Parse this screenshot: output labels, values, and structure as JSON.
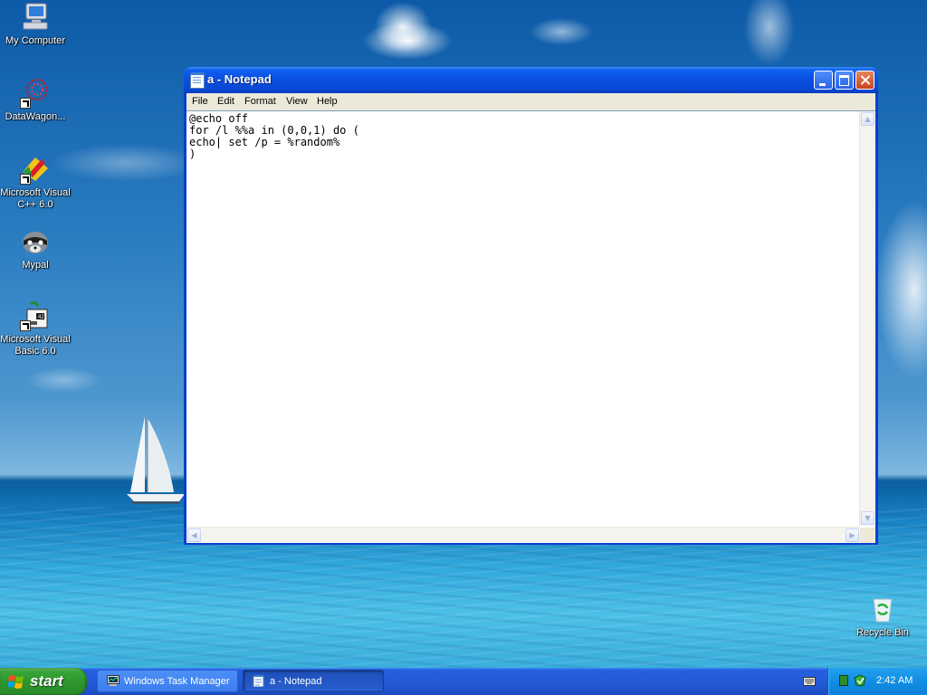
{
  "desktop": {
    "icons": [
      {
        "label": "My Computer",
        "icon": "my-computer-icon"
      },
      {
        "label": "DataWagon...",
        "icon": "datawagon-icon"
      },
      {
        "label": "Microsoft Visual C++ 6.0",
        "icon": "visual-cpp-icon"
      },
      {
        "label": "Mypal",
        "icon": "mypal-raccoon-icon"
      },
      {
        "label": "Microsoft Visual Basic 6.0",
        "icon": "visual-basic-icon"
      },
      {
        "label": "Recycle Bin",
        "icon": "recycle-bin-icon"
      }
    ]
  },
  "notepad": {
    "title": "a - Notepad",
    "menu": [
      "File",
      "Edit",
      "Format",
      "View",
      "Help"
    ],
    "content": "@echo off\nfor /l %%a in (0,0,1) do (\necho| set /p = %random%\n)"
  },
  "taskbar": {
    "start_label": "start",
    "tasks": [
      {
        "label": "Windows Task Manager",
        "icon": "task-manager-icon",
        "active": false
      },
      {
        "label": "a - Notepad",
        "icon": "notepad-icon",
        "active": true
      }
    ],
    "tray": {
      "clock": "2:42 AM",
      "icons": [
        "keyboard-icon",
        "network-icon",
        "security-shield-icon"
      ]
    }
  }
}
